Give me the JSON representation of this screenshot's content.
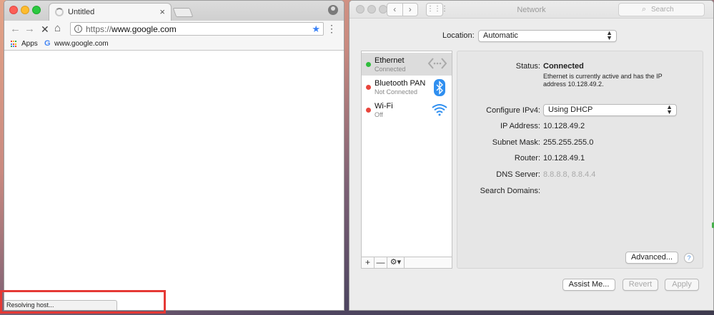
{
  "browser": {
    "tab_title": "Untitled",
    "tab_close": "×",
    "url_scheme": "https://",
    "url_host": "www.google.com",
    "bookmarks": {
      "apps_label": "Apps",
      "google_label": "www.google.com"
    },
    "status_text": "Resolving host...",
    "icons": [
      "back-icon",
      "forward-icon",
      "stop-icon",
      "home-icon",
      "info-icon",
      "star-icon",
      "menu-icon",
      "profile-icon",
      "apps-icon",
      "google-icon",
      "spinner-icon"
    ],
    "colors": {
      "star": "#3b82f6",
      "highlight": "#e53935"
    }
  },
  "network": {
    "window_title": "Network",
    "search_placeholder": "Search",
    "location_label": "Location:",
    "location_value": "Automatic",
    "services": [
      {
        "name": "Ethernet",
        "status": "Connected",
        "dot_color": "#2ebd3b",
        "icon": "ethernet-icon"
      },
      {
        "name": "Bluetooth PAN",
        "status": "Not Connected",
        "dot_color": "#e8453c",
        "icon": "bluetooth-icon"
      },
      {
        "name": "Wi-Fi",
        "status": "Off",
        "dot_color": "#e8453c",
        "icon": "wifi-icon"
      }
    ],
    "list_tools": {
      "add": "+",
      "remove": "—",
      "gear": "⚙▾"
    },
    "detail": {
      "status_label": "Status:",
      "status_value": "Connected",
      "status_description": "Ethernet is currently active and has the IP address 10.128.49.2.",
      "configure_label": "Configure IPv4:",
      "configure_value": "Using DHCP",
      "ip_label": "IP Address:",
      "ip_value": "10.128.49.2",
      "subnet_label": "Subnet Mask:",
      "subnet_value": "255.255.255.0",
      "router_label": "Router:",
      "router_value": "10.128.49.1",
      "dns_label": "DNS Server:",
      "dns_value": "8.8.8.8, 8.8.4.4",
      "search_domains_label": "Search Domains:",
      "advanced_button": "Advanced...",
      "help": "?"
    },
    "buttons": {
      "assist": "Assist Me...",
      "revert": "Revert",
      "apply": "Apply"
    }
  }
}
